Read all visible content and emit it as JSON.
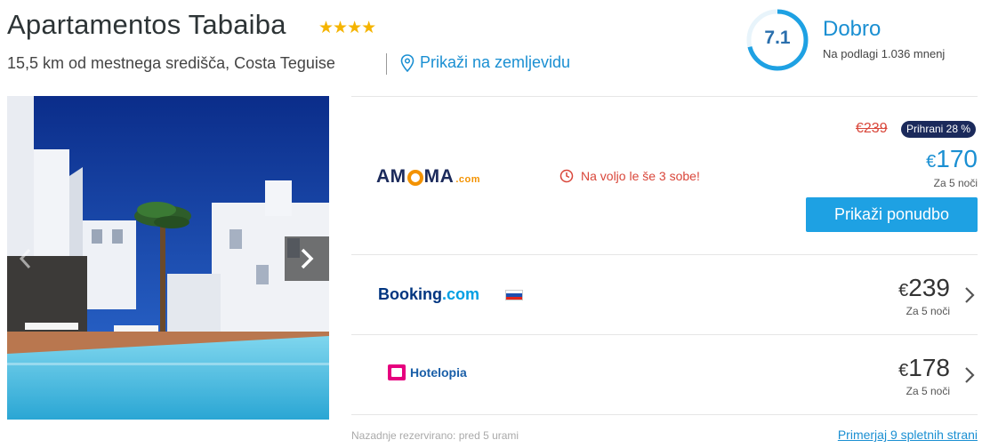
{
  "hotel": {
    "name": "Apartamentos Tabaiba",
    "stars": "★★★★",
    "star_count": 4,
    "location": "15,5 km od mestnega središča, Costa Teguise",
    "map_link": "Prikaži na zemljevidu"
  },
  "rating": {
    "score": "7.1",
    "label": "Dobro",
    "count_text": "Na podlagi 1.036 mnenj",
    "fraction": 0.71,
    "color": "#1ea1e3"
  },
  "gallery": {
    "next_icon": "chevron-right-icon",
    "prev_icon": "chevron-left-icon"
  },
  "offers": [
    {
      "provider_text": "AM",
      "provider_text2": "MA",
      "provider_suffix": ".com",
      "availability": "Na voljo le še 3 sobe!",
      "old_price": "€239",
      "discount": "Prihrani 28 %",
      "currency": "€",
      "price": "170",
      "nights": "Za 5 noči",
      "cta": "Prikaži ponudbo"
    },
    {
      "provider_text": "Booking",
      "provider_suffix": ".com",
      "currency": "€",
      "price": "239",
      "nights": "Za 5 noči"
    },
    {
      "provider_text": "Hotelopia",
      "currency": "€",
      "price": "178",
      "nights": "Za 5 noči"
    }
  ],
  "footer": {
    "last_booked": "Nazadnje rezervirano: pred 5 urami",
    "compare": "Primerjaj 9 spletnih strani"
  },
  "colors": {
    "accent": "#1a8fd2",
    "button": "#1ea1e3",
    "alert": "#d9463a",
    "badge": "#1b2a5b",
    "star": "#f5b400"
  }
}
